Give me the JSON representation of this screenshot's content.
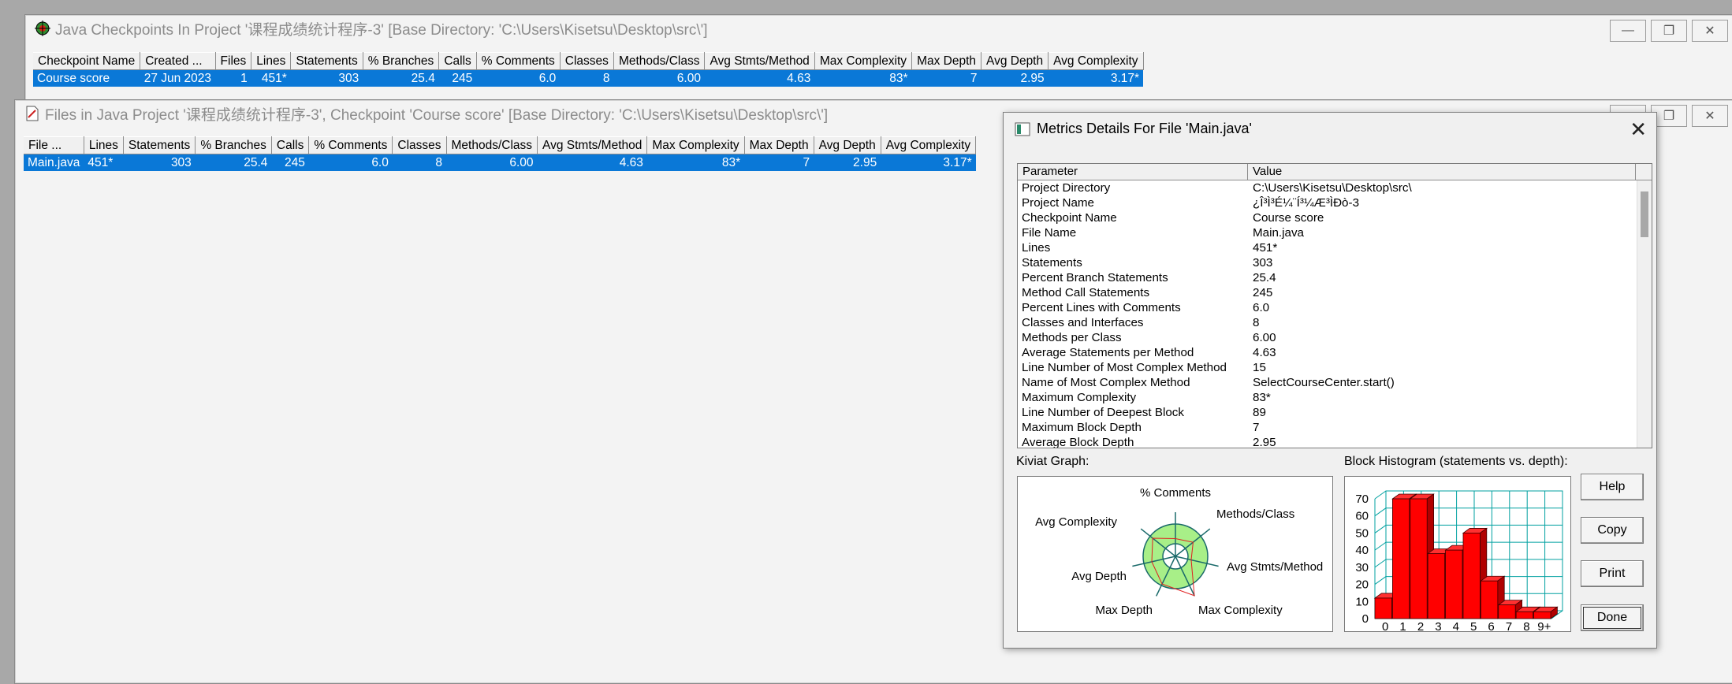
{
  "checkpoints_window": {
    "title": "Java Checkpoints In Project '课程成绩统计程序-3'  [Base Directory: 'C:\\Users\\Kisetsu\\Desktop\\src\\']",
    "columns": [
      "Checkpoint Name",
      "Created ...",
      "Files",
      "Lines",
      "Statements",
      "% Branches",
      "Calls",
      "% Comments",
      "Classes",
      "Methods/Class",
      "Avg Stmts/Method",
      "Max Complexity",
      "Max Depth",
      "Avg Depth",
      "Avg Complexity"
    ],
    "row": [
      "Course score",
      "27 Jun 2023",
      "1",
      "451*",
      "303",
      "25.4",
      "245",
      "6.0",
      "8",
      "6.00",
      "4.63",
      "83*",
      "7",
      "2.95",
      "3.17*"
    ]
  },
  "files_window": {
    "title": "Files in Java Project '课程成绩统计程序-3', Checkpoint 'Course score'  [Base Directory: 'C:\\Users\\Kisetsu\\Desktop\\src\\']",
    "columns": [
      "File ...",
      "Lines",
      "Statements",
      "% Branches",
      "Calls",
      "% Comments",
      "Classes",
      "Methods/Class",
      "Avg Stmts/Method",
      "Max Complexity",
      "Max Depth",
      "Avg Depth",
      "Avg Complexity"
    ],
    "row": [
      "Main.java",
      "451*",
      "303",
      "25.4",
      "245",
      "6.0",
      "8",
      "6.00",
      "4.63",
      "83*",
      "7",
      "2.95",
      "3.17*"
    ]
  },
  "dialog": {
    "title": "Metrics Details For File 'Main.java'",
    "close_glyph": "✕",
    "columns": [
      "Parameter",
      "Value"
    ],
    "rows": [
      {
        "name": "Project Directory",
        "value": "C:\\Users\\Kisetsu\\Desktop\\src\\"
      },
      {
        "name": "Project Name",
        "value": "¿Î³Ì³É¼¨Í³¼Æ³ÌÐò-3"
      },
      {
        "name": "Checkpoint Name",
        "value": "Course score"
      },
      {
        "name": "File Name",
        "value": "Main.java"
      },
      {
        "name": "Lines",
        "value": "451*"
      },
      {
        "name": "Statements",
        "value": "303"
      },
      {
        "name": "Percent Branch Statements",
        "value": "25.4"
      },
      {
        "name": "Method Call Statements",
        "value": "245"
      },
      {
        "name": "Percent Lines with Comments",
        "value": "6.0"
      },
      {
        "name": "Classes and Interfaces",
        "value": "8"
      },
      {
        "name": "Methods per Class",
        "value": "6.00"
      },
      {
        "name": "Average Statements per Method",
        "value": "4.63"
      },
      {
        "name": "Line Number of Most Complex Method",
        "value": "15"
      },
      {
        "name": "Name of Most Complex Method",
        "value": "SelectCourseCenter.start()"
      },
      {
        "name": "Maximum Complexity",
        "value": "83*"
      },
      {
        "name": "Line Number of Deepest Block",
        "value": "89"
      },
      {
        "name": "Maximum Block Depth",
        "value": "7"
      },
      {
        "name": "Average Block Depth",
        "value": "2.95"
      }
    ],
    "kiviat_label": "Kiviat Graph:",
    "histogram_label": "Block Histogram (statements vs. depth):",
    "buttons": {
      "help": "Help",
      "copy": "Copy",
      "print": "Print",
      "done": "Done"
    }
  },
  "chart_data": [
    {
      "type": "radar",
      "axes": [
        "% Comments",
        "Methods/Class",
        "Avg Stmts/Method",
        "Max Complexity",
        "Max Depth",
        "Avg Depth",
        "Avg Complexity"
      ]
    },
    {
      "type": "bar",
      "categories": [
        "0",
        "1",
        "2",
        "3",
        "4",
        "5",
        "6",
        "7",
        "8",
        "9+"
      ],
      "values": [
        12,
        70,
        70,
        38,
        40,
        50,
        22,
        8,
        4,
        4
      ],
      "ylim": [
        0,
        70
      ],
      "yticks": [
        "0",
        "10",
        "20",
        "30",
        "40",
        "50",
        "60",
        "70"
      ],
      "grid": true,
      "colors": {
        "bar": "#ff0000",
        "grid": "#00a0a0"
      }
    }
  ]
}
